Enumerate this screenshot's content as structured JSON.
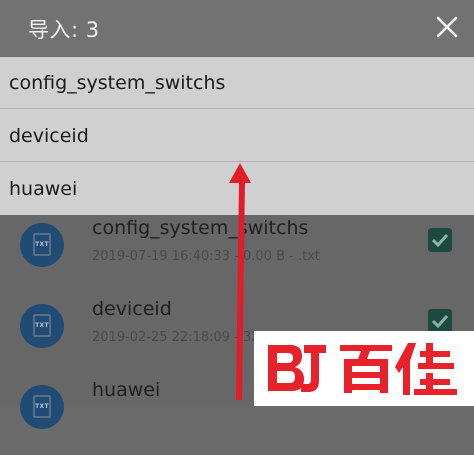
{
  "header": {
    "title": "导入: 3",
    "close_icon": "close-icon"
  },
  "dropdown": {
    "items": [
      {
        "label": "config_system_switchs"
      },
      {
        "label": "deviceid"
      },
      {
        "label": "huawei"
      }
    ]
  },
  "files": [
    {
      "name": "config_system_switchs",
      "meta": "2019-07-19 16:40:33 - 0.00 B - .txt",
      "icon_label": "TXT",
      "checked": true
    },
    {
      "name": "deviceid",
      "meta": "2019-02-25 22:18:09 - 32.00",
      "icon_label": "TXT",
      "checked": true
    },
    {
      "name": "huawei",
      "meta": "",
      "icon_label": "TXT",
      "checked": true
    }
  ],
  "watermark": {
    "text": "BJ百佳",
    "colors": {
      "primary": "#e8222b"
    }
  },
  "colors": {
    "annotation_arrow": "#e11d2a",
    "titlebar": "#727272",
    "dropdown_bg": "#d0d0d0",
    "file_icon": "#1f4b74",
    "checkbox": "#1d4a40"
  }
}
